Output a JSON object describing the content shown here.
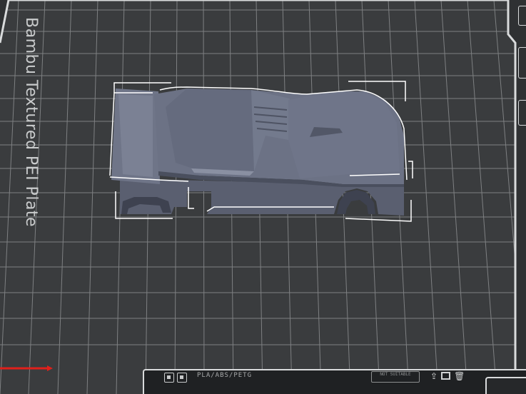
{
  "plate": {
    "label": "Bambu Textured PEI Plate"
  },
  "bottom_strip": {
    "text": "PLA/ABS/PETG",
    "box_text": "NOT SUITABLE"
  },
  "colors": {
    "grid_line": "#8a8c8e",
    "bed_background": "#3a3c3e",
    "model": "#6e7487",
    "selection_box": "#ffffff",
    "x_axis": "#e0201b"
  },
  "icons": {
    "plate-icon-a": "square-icon",
    "plate-icon-b": "square-icon",
    "right-icon-1": "upload-icon",
    "right-icon-2": "square-outline-icon",
    "right-icon-3": "trash-icon"
  }
}
